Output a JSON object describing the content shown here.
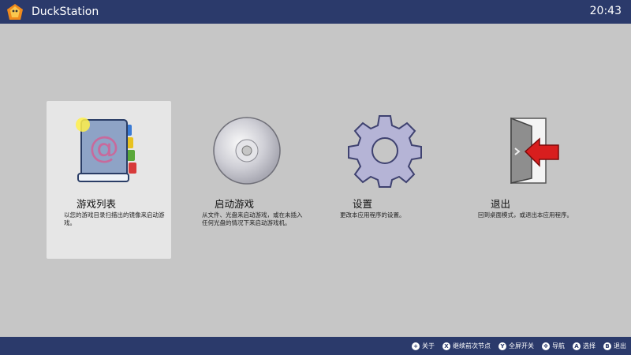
{
  "header": {
    "title": "DuckStation",
    "clock": "20:43"
  },
  "menu": [
    {
      "id": "game-list",
      "label": "游戏列表",
      "description": "以您的游戏目录扫描出的镜像来启动游戏。",
      "icon": "address-book-icon",
      "selected": true
    },
    {
      "id": "start-game",
      "label": "启动游戏",
      "description": "从文件、光盘来启动游戏，或在未插入任何光盘的情况下来启动游戏机。",
      "icon": "disc-icon",
      "selected": false
    },
    {
      "id": "settings",
      "label": "设置",
      "description": "更改本应用程序的设置。",
      "icon": "gear-icon",
      "selected": false
    },
    {
      "id": "exit",
      "label": "退出",
      "description": "回到桌面模式，或退出本应用程序。",
      "icon": "exit-door-icon",
      "selected": false
    }
  ],
  "footer": {
    "hints": [
      {
        "glyph": "+",
        "label": "关于"
      },
      {
        "glyph": "X",
        "label": "继续前次节点"
      },
      {
        "glyph": "Y",
        "label": "全屏开关"
      },
      {
        "glyph": "✥",
        "label": "导航"
      },
      {
        "glyph": "A",
        "label": "选择"
      },
      {
        "glyph": "B",
        "label": "退出"
      }
    ]
  },
  "colors": {
    "bar": "#2b3a6b",
    "background": "#c6c6c6",
    "selected_tile": "#e6e6e6"
  }
}
